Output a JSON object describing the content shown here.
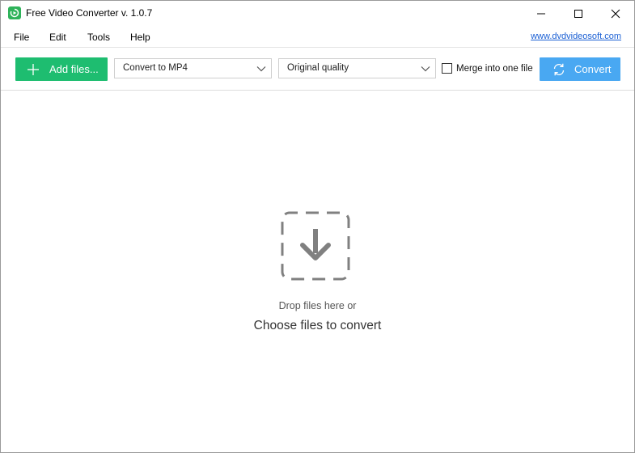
{
  "window": {
    "title": "Free Video Converter v. 1.0.7",
    "icon": "app-logo-icon",
    "controls": [
      "minimize-icon",
      "maximize-icon",
      "close-icon"
    ]
  },
  "menu": {
    "items": [
      {
        "label": "File"
      },
      {
        "label": "Edit"
      },
      {
        "label": "Tools"
      },
      {
        "label": "Help"
      }
    ],
    "website_link": "www.dvdvideosoft.com"
  },
  "toolbar": {
    "add_files_label": "Add files...",
    "format_select": {
      "value": "Convert to MP4"
    },
    "quality_select": {
      "value": "Original quality"
    },
    "merge_checkbox": {
      "label": "Merge into one file",
      "checked": false
    },
    "convert_label": "Convert"
  },
  "dropzone": {
    "hint": "Drop files here or",
    "action_text": "Choose files to convert",
    "icon": "download-arrow-icon"
  },
  "colors": {
    "add_button": "#1ebd70",
    "convert_button": "#49a8f2",
    "link": "#1a5fd4",
    "app_icon": "#2fb35a"
  }
}
